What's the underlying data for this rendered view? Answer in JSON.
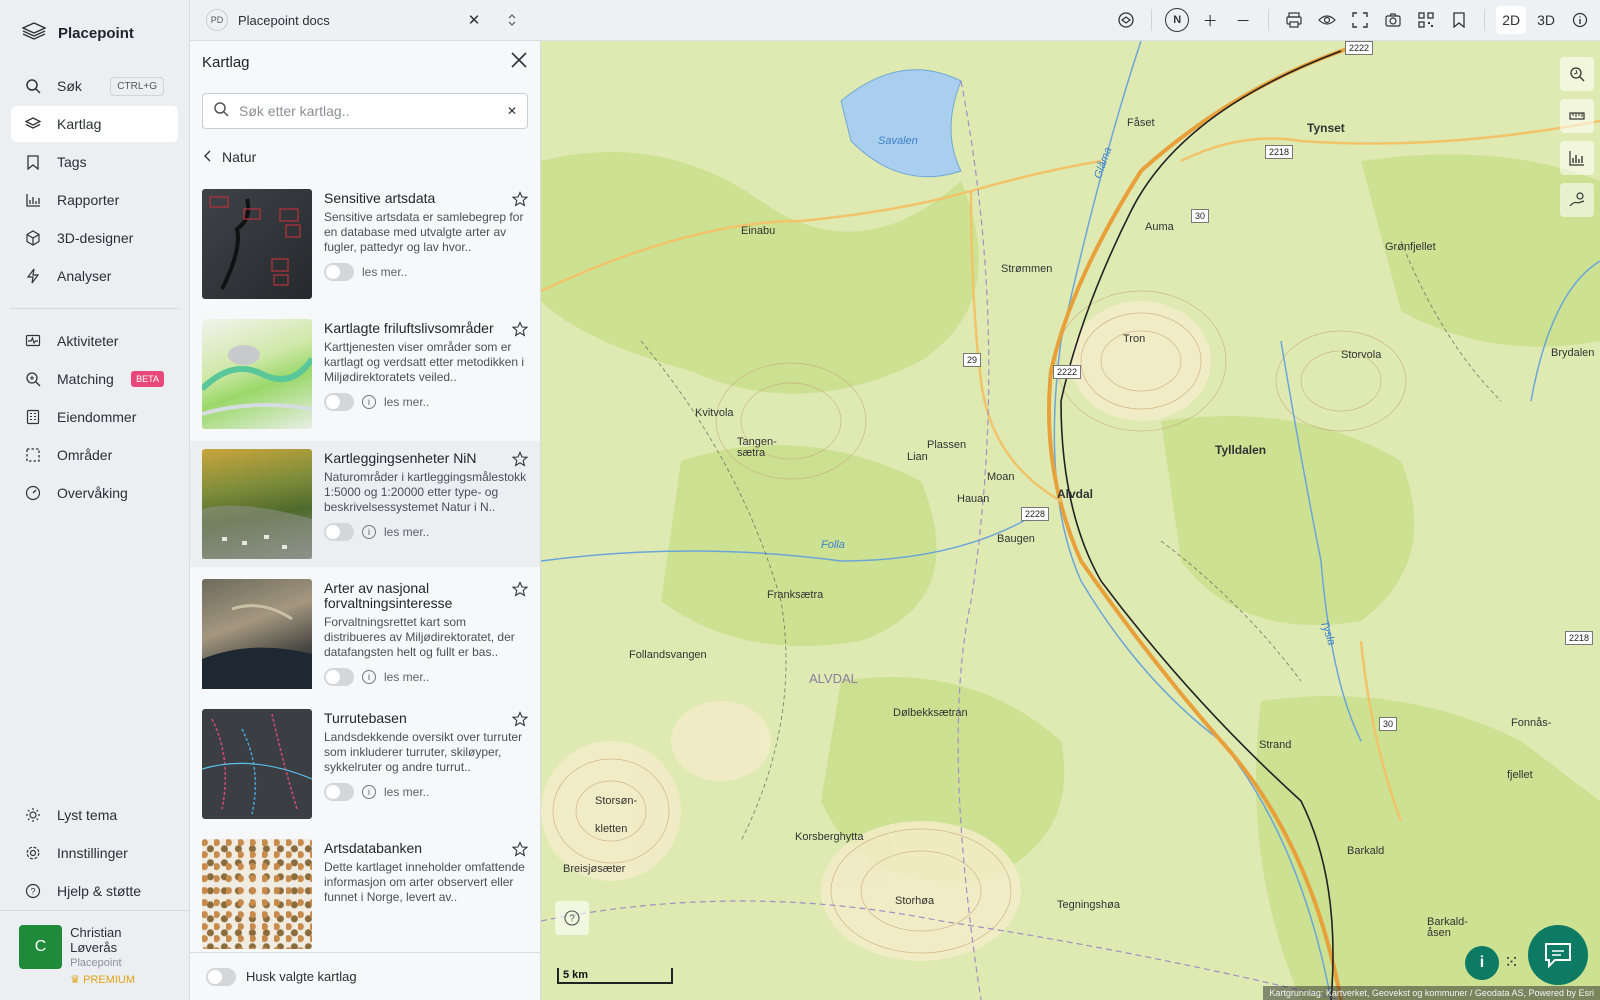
{
  "brand": {
    "label": "Placepoint"
  },
  "nav": {
    "items": [
      {
        "label": "Søk",
        "icon": "search-icon",
        "shortcut": "CTRL+G"
      },
      {
        "label": "Kartlag",
        "icon": "layers-icon",
        "active": true
      },
      {
        "label": "Tags",
        "icon": "bookmark-icon"
      },
      {
        "label": "Rapporter",
        "icon": "chart-icon"
      },
      {
        "label": "3D-designer",
        "icon": "cube-icon"
      },
      {
        "label": "Analyser",
        "icon": "bolt-icon"
      }
    ],
    "items2": [
      {
        "label": "Aktiviteter",
        "icon": "activity-icon"
      },
      {
        "label": "Matching",
        "icon": "match-icon",
        "badge": "BETA"
      },
      {
        "label": "Eiendommer",
        "icon": "building-icon"
      },
      {
        "label": "Områder",
        "icon": "area-icon"
      },
      {
        "label": "Overvåking",
        "icon": "gauge-icon"
      }
    ],
    "bottom": [
      {
        "label": "Lyst tema",
        "icon": "sun-icon"
      },
      {
        "label": "Innstillinger",
        "icon": "gear-icon"
      },
      {
        "label": "Hjelp & støtte",
        "icon": "help-icon"
      }
    ]
  },
  "user": {
    "initial": "C",
    "name": "Christian Løverås",
    "org": "Placepoint",
    "plan": "PREMIUM"
  },
  "topbar": {
    "doc_badge": "PD",
    "doc_title": "Placepoint docs",
    "north": "N",
    "mode_2d": "2D",
    "mode_3d": "3D"
  },
  "panel": {
    "title": "Kartlag",
    "search_placeholder": "Søk etter kartlag..",
    "breadcrumb": "Natur",
    "read_more": "les mer..",
    "remember_label": "Husk valgte kartlag",
    "layers": [
      {
        "title": "Sensitive artsdata",
        "desc": "Sensitive artsdata er samlebegrep for en database med utvalgte arter av fugler, pattedyr og lav hvor..",
        "info": false,
        "thumb": "dark-red"
      },
      {
        "title": "Kartlagte friluftslivsområder",
        "desc": "Karttjenesten viser områder som er kartlagt og verdsatt etter metodikken i Miljødirektoratets veiled..",
        "info": true,
        "thumb": "green-map"
      },
      {
        "title": "Kartleggingsenheter NiN",
        "desc": "Naturområder i kartleggingsmålestokk 1:5000 og 1:20000 etter type- og beskrivelsessystemet Natur i N..",
        "info": true,
        "thumb": "aerial",
        "highlight": true
      },
      {
        "title": "Arter av nasjonal forvaltningsinteresse",
        "desc": "Forvaltningsrettet kart som distribueres av Miljødirektoratet, der datafangsten helt og fullt er bas..",
        "info": true,
        "thumb": "aerial-coast"
      },
      {
        "title": "Turrutebasen",
        "desc": "Landsdekkende oversikt over turruter som inkluderer turruter, skiløyper, sykkelruter og andre turrut..",
        "info": true,
        "thumb": "dark-routes"
      },
      {
        "title": "Artsdatabanken",
        "desc": "Dette kartlaget inneholder omfattende informasjon om arter observert eller funnet i Norge, levert av..",
        "info": false,
        "thumb": "dots"
      }
    ]
  },
  "map": {
    "scale": "5 km",
    "attribution": "Kartgrunnlag: Kartverket, Geovekst og kommuner / Geodata AS, Powered by Esri",
    "labels": [
      {
        "text": "Savalen",
        "kind": "water"
      },
      {
        "text": "Fåset",
        "kind": ""
      },
      {
        "text": "Tynset",
        "kind": "big"
      },
      {
        "text": "Auma",
        "kind": ""
      },
      {
        "text": "Grønfjellet",
        "kind": ""
      },
      {
        "text": "Einabu",
        "kind": ""
      },
      {
        "text": "Strømmen",
        "kind": ""
      },
      {
        "text": "Tron",
        "kind": ""
      },
      {
        "text": "Storvola",
        "kind": ""
      },
      {
        "text": "Brydalen",
        "kind": ""
      },
      {
        "text": "Kvitvola",
        "kind": ""
      },
      {
        "text": "Tangen-\nsætra",
        "kind": ""
      },
      {
        "text": "Plassen",
        "kind": ""
      },
      {
        "text": "Lian",
        "kind": ""
      },
      {
        "text": "Moan",
        "kind": ""
      },
      {
        "text": "Hauan",
        "kind": ""
      },
      {
        "text": "Alvdal",
        "kind": "big"
      },
      {
        "text": "Tylldalen",
        "kind": "big"
      },
      {
        "text": "Baugen",
        "kind": ""
      },
      {
        "text": "Folla",
        "kind": "water"
      },
      {
        "text": "Franksætra",
        "kind": ""
      },
      {
        "text": "Follandsvangen",
        "kind": ""
      },
      {
        "text": "ALVDAL",
        "kind": "muni"
      },
      {
        "text": "Dølbekksætran",
        "kind": ""
      },
      {
        "text": "Storsøn-\nkletten",
        "kind": ""
      },
      {
        "text": "Korsberghytta",
        "kind": ""
      },
      {
        "text": "Storhøa",
        "kind": ""
      },
      {
        "text": "Tegningshøa",
        "kind": ""
      },
      {
        "text": "Strand",
        "kind": ""
      },
      {
        "text": "Barkald",
        "kind": ""
      },
      {
        "text": "Barkald-\nåsen",
        "kind": ""
      },
      {
        "text": "Fonnås-",
        "kind": ""
      },
      {
        "text": "fjellet",
        "kind": ""
      },
      {
        "text": "Breisjøsæter",
        "kind": ""
      },
      {
        "text": "Glåma",
        "kind": "water"
      },
      {
        "text": "Tysla",
        "kind": "water"
      }
    ],
    "shields": [
      "2222",
      "2218",
      "30",
      "29",
      "2222",
      "2228",
      "2218",
      "30"
    ],
    "colors": {
      "terrain": "#dfeab2",
      "forest": "#c9dd8f",
      "road": "#e8a13a",
      "water": "#aacfee",
      "rail": "#222222"
    }
  }
}
